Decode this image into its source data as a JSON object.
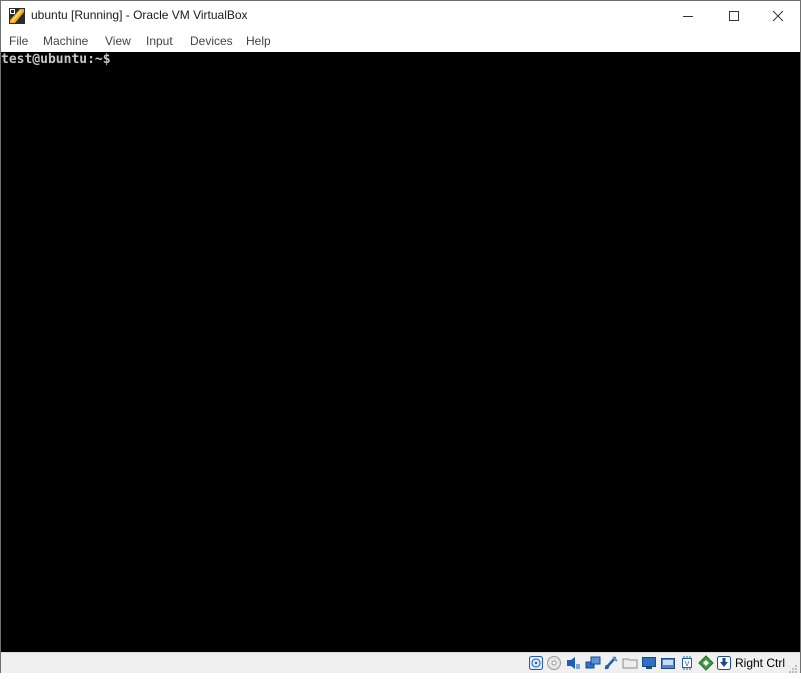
{
  "window": {
    "title": "ubuntu [Running] - Oracle VM VirtualBox",
    "icons": {
      "app": "virtualbox-app-icon",
      "minimize": "minimize-icon",
      "maximize": "maximize-icon",
      "close": "close-icon"
    }
  },
  "menubar": {
    "items": [
      {
        "label": "File"
      },
      {
        "label": "Machine"
      },
      {
        "label": "View"
      },
      {
        "label": "Input"
      },
      {
        "label": "Devices"
      },
      {
        "label": "Help"
      }
    ]
  },
  "console": {
    "prompt": "test@ubuntu:~$",
    "background": "#000000",
    "text_color": "#c8c8c8"
  },
  "statusbar": {
    "indicators": [
      "hard-disk-icon",
      "optical-drive-icon",
      "audio-icon",
      "network-icon",
      "usb-icon",
      "shared-folders-icon",
      "display-icon",
      "recording-icon",
      "cpu-icon",
      "mouse-integration-icon",
      "keyboard-capture-icon"
    ],
    "host_key": "Right Ctrl"
  },
  "colors": {
    "accent": "#1e5fb4",
    "titlebar_bg": "#ffffff",
    "statusbar_bg": "#f0f0f0"
  }
}
